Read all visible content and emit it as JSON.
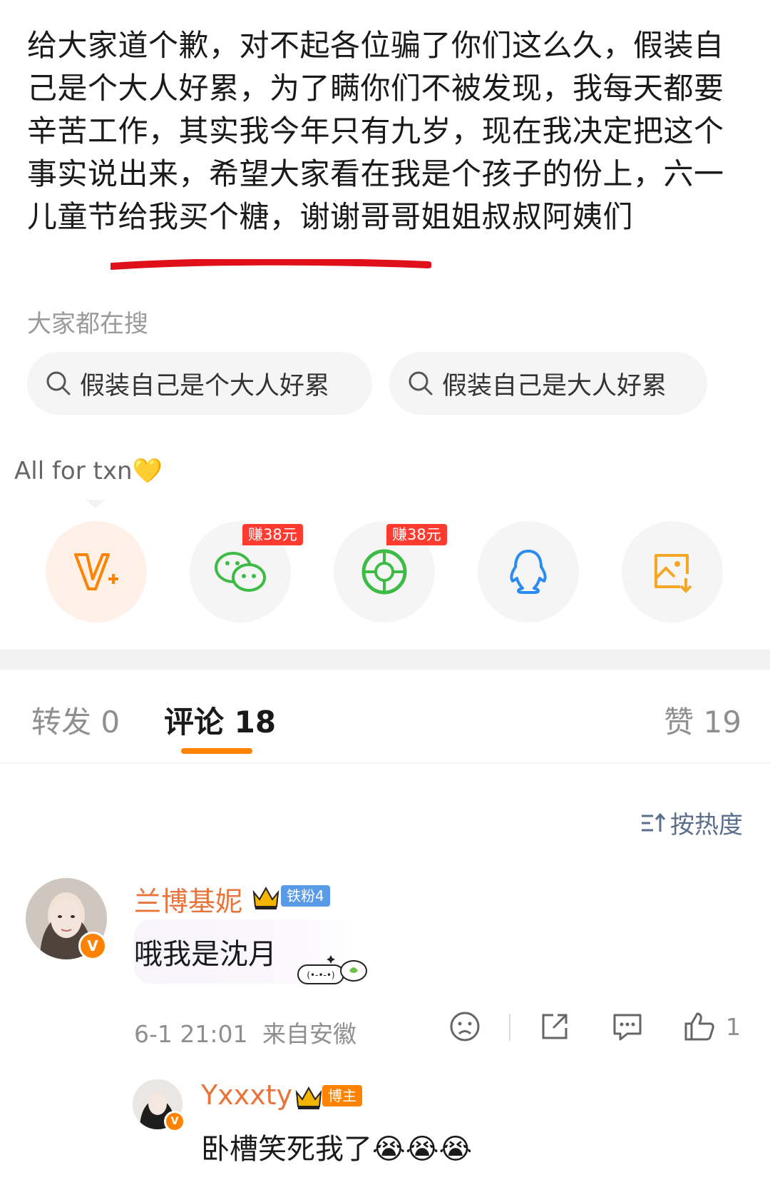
{
  "post": {
    "text": "给大家道个歉，对不起各位骗了你们这么久，假装自己是个大人好累，为了瞒你们不被发现，我每天都要辛苦工作，其实我今年只有九岁，现在我决定把这个事实说出来，希望大家看在我是个孩子的份上，六一儿童节给我买个糖，谢谢哥哥姐姐叔叔阿姨们"
  },
  "search": {
    "heading": "大家都在搜",
    "chips": [
      "假装自己是个大人好累",
      "假装自己是大人好累"
    ]
  },
  "share": {
    "bubble_text": "All for txn💛",
    "earn_badge": "赚38元",
    "icons": [
      "v-plus-icon",
      "wechat-icon",
      "moments-icon",
      "qq-icon",
      "save-image-icon"
    ]
  },
  "tabs": {
    "repost_label": "转发",
    "repost_count": "0",
    "comments_label": "评论",
    "comments_count": "18",
    "likes_label": "赞",
    "likes_count": "19"
  },
  "sort": {
    "label": "按热度"
  },
  "comment": {
    "username": "兰博基妮",
    "fan_badge": "铁粉4",
    "text": "哦我是沈月",
    "sticker_text": "(•-•-•)",
    "time": "6-1 21:01",
    "location": "来自安徽",
    "like_count": "1"
  },
  "reply": {
    "username": "Yxxxty",
    "badge": "博主",
    "text": "卧槽笑死我了😭😭😭"
  },
  "colors": {
    "accent_orange": "#ff8200",
    "username_orange": "#e8743b",
    "badge_red": "#ff3b30",
    "fan_badge_blue": "#5a9be8",
    "sort_blue": "#5b6e8c",
    "underline_red": "#e0101a"
  }
}
